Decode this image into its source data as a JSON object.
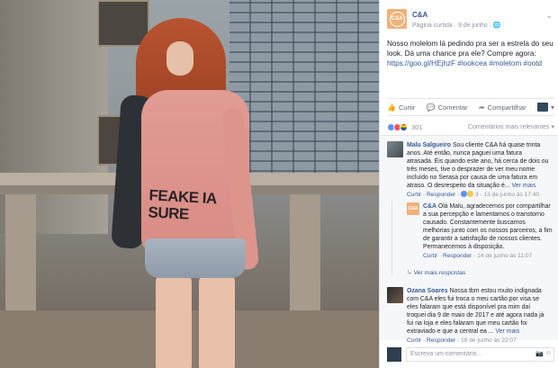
{
  "post": {
    "page_name": "C&A",
    "avatar_text": "C&A",
    "meta": "Página curtida · 9 de junho · ",
    "text_main": "Nosso molelom lá pedindo pra ser a estrela do seu look. Dá uma chance pra ele? Compre agora:",
    "text_links": "https://goo.gl/HEjhzF #lookcea #moletom #ootd",
    "sweater_print": "FEAKE IA SURE"
  },
  "actions": {
    "like": "Curtir",
    "comment": "Comentar",
    "share": "Compartilhar"
  },
  "reactions": {
    "count": "301",
    "sort_label": "Comentários mais relevantes ▾"
  },
  "comments": [
    {
      "author": "Malu Salgueiro",
      "text": "Sou cliente C&A há quase trinta anos. Até então, nunca paguei uma fatura atrasada. Eis quando este ano, há cerca de dois ou três meses, tive o desprazer de ver meu nome incluído no Serasa por causa de uma fatura em atraso. O desrespeito da situação é...",
      "more": "Ver mais",
      "like": "Curtir",
      "reply": "Responder",
      "reaction_count": "3",
      "time": "13 de junho às 17:40"
    },
    {
      "author": "C&A",
      "text": "Olá Malu, agradecemos por compartilhar a sua percepção e lamentamos o transtorno causado. Constantemente buscamos melhorias junto com os nossos parceiros, a fim de garantir a satisfação de nossos clientes. Permanecemos à disposição.",
      "like": "Curtir",
      "reply": "Responder",
      "time": "14 de junho às 11:07"
    },
    {
      "author": "Ozana Soares",
      "text": "Nossa tbm estou muito indignada com C&A eles fui troca o meu cartão por visa se eles falaram que está disponível pra mim daí troquei dia 9 de maio de 2017 e até agora nada já fui na loja e eles falaram que meu cartão foi extraviado e que a central ea ...",
      "more": "Ver mais",
      "like": "Curtir",
      "reply": "Responder",
      "time": "18 de junho às 22:07"
    }
  ],
  "see_replies": "Ver mais respostas",
  "composer": {
    "placeholder": "Escreva um comentário..."
  },
  "colors": {
    "link": "#365899",
    "brand": "#f0b27a"
  }
}
